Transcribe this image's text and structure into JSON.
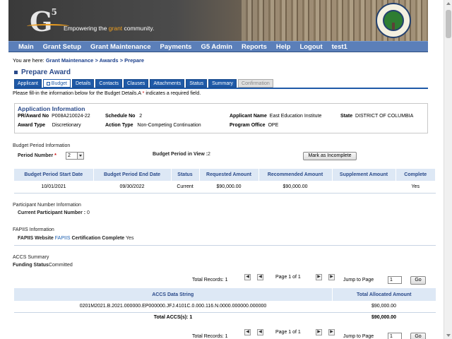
{
  "banner": {
    "logo": "G",
    "logo_sup": "5",
    "tagline_pre": "Empowering the ",
    "tagline_accent": "grant",
    "tagline_post": " community."
  },
  "nav": [
    "Main",
    "Grant Setup",
    "Grant Maintenance",
    "Payments",
    "G5 Admin",
    "Reports",
    "Help",
    "Logout",
    "test1"
  ],
  "breadcrumb": {
    "prefix": "You are here: ",
    "items": [
      "Grant Maintenance",
      "Awards",
      "Prepare"
    ],
    "sep": " > "
  },
  "page_title": "Prepare Award",
  "tabs": [
    "Applicant",
    "Budget",
    "Details",
    "Contacts",
    "Clauses",
    "Attachments",
    "Status",
    "Summary",
    "Confirmation"
  ],
  "instructions": {
    "text": "Please fill-in the information below for the Budget Details.A ",
    "star": "*",
    "suffix": " indicates a required field."
  },
  "application_info": {
    "header": "Application Information",
    "pr_award_label": "PR/Award No",
    "pr_award_value": "P008A210024-22",
    "schedule_label": "Schedule No",
    "schedule_value": "2",
    "applicant_label": "Applicant Name",
    "applicant_value": "East Education Institute",
    "state_label": "State",
    "state_value": "DISTRICT OF COLUMBIA",
    "award_type_label": "Award Type",
    "award_type_value": "Discretionary",
    "action_type_label": "Action Type",
    "action_type_value": "Non-Competing Continuation",
    "program_office_label": "Program Office",
    "program_office_value": "OPE"
  },
  "budget_period": {
    "section_label": "Budget Period Information",
    "period_number_label": "Period Number",
    "required_star": "*",
    "period_number_value": "2",
    "in_view_label": "Budget Period in View :",
    "in_view_value": "2",
    "mark_button": "Mark as Incomplete",
    "columns": [
      "Budget Period Start Date",
      "Budget Period End Date",
      "Status",
      "Requested Amount",
      "Recommended Amount",
      "Supplement Amount",
      "Complete"
    ],
    "rows": [
      [
        "10/01/2021",
        "09/30/2022",
        "Current",
        "$90,000.00",
        "$90,000.00",
        "",
        "Yes"
      ]
    ]
  },
  "participant": {
    "section_label": "Participant Number Information",
    "label": "Current Participant Number :",
    "value": " 0"
  },
  "fapiis": {
    "section_label": "FAPIIS Information",
    "label_pre": "FAPIIS Website ",
    "link": "FAPIIS",
    "label_post": " Certification Complete",
    "value": " Yes"
  },
  "accs": {
    "section_label": "ACCS Summary",
    "funding_label": "Funding Status",
    "funding_value": "Committed",
    "pager": {
      "total": "Total Records: 1",
      "page": "Page 1 of 1",
      "jump_label": "Jump to Page",
      "jump_value": "1",
      "go": "Go"
    },
    "columns": [
      "ACCS Data String",
      "Total Allocated Amount"
    ],
    "rows": [
      [
        "0201M2021.B.2021.000000.EP000000.JFJ.4101C.0.000.116.N.0000.000000.000000",
        "$90,000.00"
      ]
    ],
    "total_label": "Total ACCS(s): 1",
    "total_value": "$90,000.00"
  },
  "colors": {
    "nav": "#5b7fb9",
    "tab": "#1f5aa8",
    "title": "#2a4a8a",
    "header_bg": "#dde8f5",
    "accent": "#f0a020"
  }
}
